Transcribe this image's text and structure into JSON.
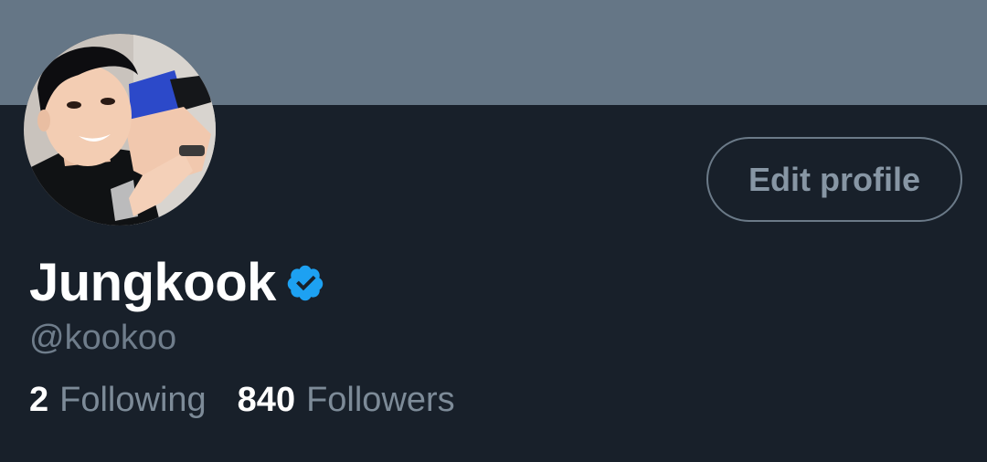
{
  "profile": {
    "display_name": "Jungkook",
    "handle": "@kookoo",
    "edit_label": "Edit profile",
    "verified_icon": "verified-badge-icon",
    "following_count": "2",
    "following_label": "Following",
    "followers_count": "840",
    "followers_label": "Followers"
  },
  "colors": {
    "banner": "#657686",
    "background": "#18202a",
    "verified": "#1da1f2",
    "muted_text": "#6f7d8b"
  }
}
